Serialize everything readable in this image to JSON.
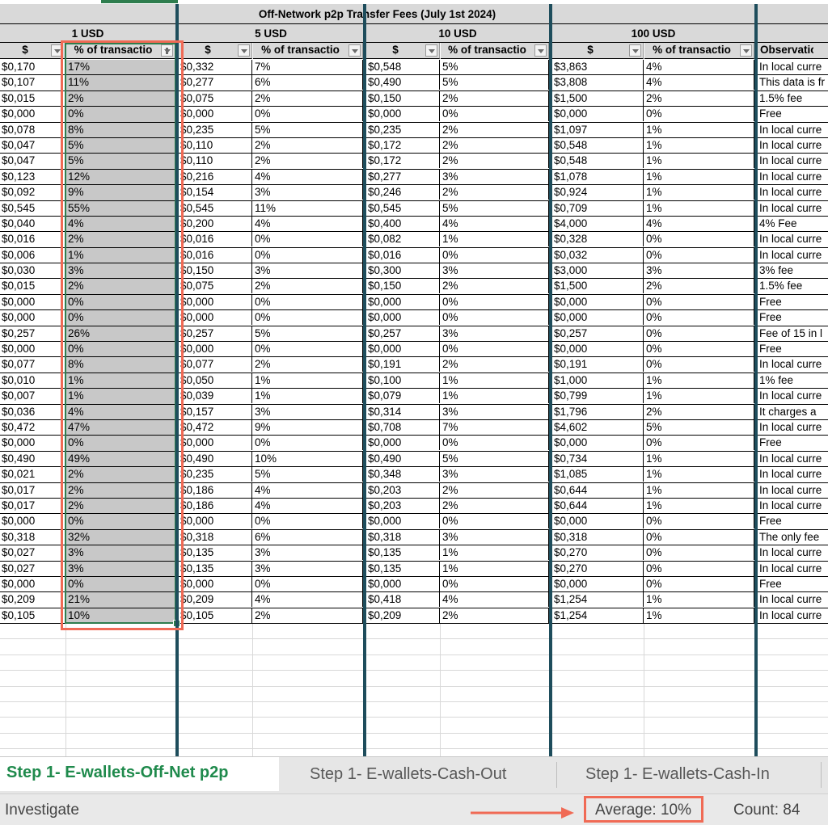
{
  "sheet": {
    "title": "Off-Network p2p Transfer Fees (July 1st 2024)",
    "groups": [
      "1 USD",
      "5 USD",
      "10 USD",
      "100 USD"
    ],
    "col_headers": {
      "usd": "$",
      "pct": "% of transactio",
      "obs": "Observation"
    },
    "rows": [
      [
        "$0,170",
        "17%",
        "$0,332",
        "7%",
        "$0,548",
        "5%",
        "$3,863",
        "4%",
        "In local curre"
      ],
      [
        "$0,107",
        "11%",
        "$0,277",
        "6%",
        "$0,490",
        "5%",
        "$3,808",
        "4%",
        "This data is fr"
      ],
      [
        "$0,015",
        "2%",
        "$0,075",
        "2%",
        "$0,150",
        "2%",
        "$1,500",
        "2%",
        "1.5% fee"
      ],
      [
        "$0,000",
        "0%",
        "$0,000",
        "0%",
        "$0,000",
        "0%",
        "$0,000",
        "0%",
        "Free"
      ],
      [
        "$0,078",
        "8%",
        "$0,235",
        "5%",
        "$0,235",
        "2%",
        "$1,097",
        "1%",
        "In local curre"
      ],
      [
        "$0,047",
        "5%",
        "$0,110",
        "2%",
        "$0,172",
        "2%",
        "$0,548",
        "1%",
        "In local curre"
      ],
      [
        "$0,047",
        "5%",
        "$0,110",
        "2%",
        "$0,172",
        "2%",
        "$0,548",
        "1%",
        "In local curre"
      ],
      [
        "$0,123",
        "12%",
        "$0,216",
        "4%",
        "$0,277",
        "3%",
        "$1,078",
        "1%",
        "In local curre"
      ],
      [
        "$0,092",
        "9%",
        "$0,154",
        "3%",
        "$0,246",
        "2%",
        "$0,924",
        "1%",
        "In local curre"
      ],
      [
        "$0,545",
        "55%",
        "$0,545",
        "11%",
        "$0,545",
        "5%",
        "$0,709",
        "1%",
        "In local curre"
      ],
      [
        "$0,040",
        "4%",
        "$0,200",
        "4%",
        "$0,400",
        "4%",
        "$4,000",
        "4%",
        "4% Fee"
      ],
      [
        "$0,016",
        "2%",
        "$0,016",
        "0%",
        "$0,082",
        "1%",
        "$0,328",
        "0%",
        "In local curre"
      ],
      [
        "$0,006",
        "1%",
        "$0,016",
        "0%",
        "$0,016",
        "0%",
        "$0,032",
        "0%",
        "In local curre"
      ],
      [
        "$0,030",
        "3%",
        "$0,150",
        "3%",
        "$0,300",
        "3%",
        "$3,000",
        "3%",
        "3% fee"
      ],
      [
        "$0,015",
        "2%",
        "$0,075",
        "2%",
        "$0,150",
        "2%",
        "$1,500",
        "2%",
        "1.5% fee"
      ],
      [
        "$0,000",
        "0%",
        "$0,000",
        "0%",
        "$0,000",
        "0%",
        "$0,000",
        "0%",
        "Free"
      ],
      [
        "$0,000",
        "0%",
        "$0,000",
        "0%",
        "$0,000",
        "0%",
        "$0,000",
        "0%",
        "Free"
      ],
      [
        "$0,257",
        "26%",
        "$0,257",
        "5%",
        "$0,257",
        "3%",
        "$0,257",
        "0%",
        "Fee of 15 in l"
      ],
      [
        "$0,000",
        "0%",
        "$0,000",
        "0%",
        "$0,000",
        "0%",
        "$0,000",
        "0%",
        "Free"
      ],
      [
        "$0,077",
        "8%",
        "$0,077",
        "2%",
        "$0,191",
        "2%",
        "$0,191",
        "0%",
        "In local curre"
      ],
      [
        "$0,010",
        "1%",
        "$0,050",
        "1%",
        "$0,100",
        "1%",
        "$1,000",
        "1%",
        "1% fee"
      ],
      [
        "$0,007",
        "1%",
        "$0,039",
        "1%",
        "$0,079",
        "1%",
        "$0,799",
        "1%",
        "In local curre"
      ],
      [
        "$0,036",
        "4%",
        "$0,157",
        "3%",
        "$0,314",
        "3%",
        "$1,796",
        "2%",
        "It charges a"
      ],
      [
        "$0,472",
        "47%",
        "$0,472",
        "9%",
        "$0,708",
        "7%",
        "$4,602",
        "5%",
        "In local curre"
      ],
      [
        "$0,000",
        "0%",
        "$0,000",
        "0%",
        "$0,000",
        "0%",
        "$0,000",
        "0%",
        "Free"
      ],
      [
        "$0,490",
        "49%",
        "$0,490",
        "10%",
        "$0,490",
        "5%",
        "$0,734",
        "1%",
        "In local curre"
      ],
      [
        "$0,021",
        "2%",
        "$0,235",
        "5%",
        "$0,348",
        "3%",
        "$1,085",
        "1%",
        "In local curre"
      ],
      [
        "$0,017",
        "2%",
        "$0,186",
        "4%",
        "$0,203",
        "2%",
        "$0,644",
        "1%",
        "In local curre"
      ],
      [
        "$0,017",
        "2%",
        "$0,186",
        "4%",
        "$0,203",
        "2%",
        "$0,644",
        "1%",
        "In local curre"
      ],
      [
        "$0,000",
        "0%",
        "$0,000",
        "0%",
        "$0,000",
        "0%",
        "$0,000",
        "0%",
        "Free"
      ],
      [
        "$0,318",
        "32%",
        "$0,318",
        "6%",
        "$0,318",
        "3%",
        "$0,318",
        "0%",
        "The only fee"
      ],
      [
        "$0,027",
        "3%",
        "$0,135",
        "3%",
        "$0,135",
        "1%",
        "$0,270",
        "0%",
        "In local curre"
      ],
      [
        "$0,027",
        "3%",
        "$0,135",
        "3%",
        "$0,135",
        "1%",
        "$0,270",
        "0%",
        "In local curre"
      ],
      [
        "$0,000",
        "0%",
        "$0,000",
        "0%",
        "$0,000",
        "0%",
        "$0,000",
        "0%",
        "Free"
      ],
      [
        "$0,209",
        "21%",
        "$0,209",
        "4%",
        "$0,418",
        "4%",
        "$1,254",
        "1%",
        "In local curre"
      ],
      [
        "$0,105",
        "10%",
        "$0,105",
        "2%",
        "$0,209",
        "2%",
        "$1,254",
        "1%",
        "In local curre"
      ]
    ]
  },
  "tabs": [
    {
      "label": "Step 1- E-wallets-Off-Net p2p",
      "active": true
    },
    {
      "label": "Step 1- E-wallets-Cash-Out",
      "active": false
    },
    {
      "label": "Step 1- E-wallets-Cash-In",
      "active": false
    }
  ],
  "status_bar": {
    "left": "Investigate",
    "average": "Average: 10%",
    "count": "Count: 84"
  },
  "colors": {
    "accent_green": "#1f8a4c",
    "annotation_red": "#f06a55",
    "group_divider": "#1e4d5c",
    "header_gray": "#d9d9d9",
    "selection_gray": "#c8c8c8"
  }
}
